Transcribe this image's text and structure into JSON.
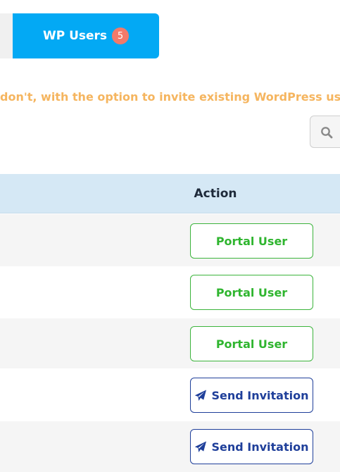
{
  "tabs": {
    "wp_users": {
      "label": "WP Users",
      "count": "5"
    }
  },
  "notice_text": "don't, with the option to invite existing WordPress users to th",
  "search": {
    "icon": "search-icon"
  },
  "table": {
    "header": {
      "action": "Action"
    },
    "rows": [
      {
        "action_label": "Portal User",
        "type": "portal"
      },
      {
        "action_label": "Portal User",
        "type": "portal"
      },
      {
        "action_label": "Portal User",
        "type": "portal"
      },
      {
        "action_label": "Send Invitation",
        "type": "invite",
        "icon": "paper-plane-icon"
      },
      {
        "action_label": "Send Invitation",
        "type": "invite",
        "icon": "paper-plane-icon"
      }
    ]
  },
  "colors": {
    "tab_active": "#03a9f4",
    "badge": "#f27a6a",
    "notice": "#f5b55f",
    "portal_green": "#2fb52f",
    "invite_blue": "#1f3f9a",
    "header_bg": "#d5e8f5"
  }
}
